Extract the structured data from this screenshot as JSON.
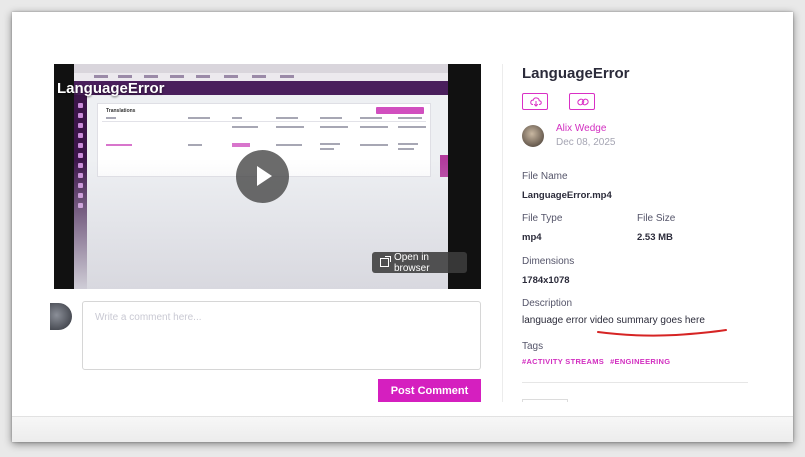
{
  "video": {
    "overlay_title": "LanguageError",
    "open_in_browser_label": "Open in browser",
    "embedded_screen_title": "Translations"
  },
  "comment": {
    "placeholder": "Write a comment here...",
    "post_label": "Post Comment"
  },
  "file": {
    "title": "LanguageError",
    "author": "Alix Wedge",
    "date": "Dec 08, 2025",
    "file_name_label": "File Name",
    "file_name": "LanguageError.mp4",
    "file_type_label": "File Type",
    "file_type": "mp4",
    "file_size_label": "File Size",
    "file_size": "2.53 MB",
    "dimensions_label": "Dimensions",
    "dimensions": "1784x1078",
    "description_label": "Description",
    "description": "language error video summary goes here",
    "tags_label": "Tags",
    "tags": [
      "#ACTIVITY STREAMS",
      "#ENGINEERING"
    ]
  },
  "icons": {
    "download": "download-icon",
    "link": "link-icon",
    "play": "play-icon",
    "external": "external-link-icon"
  },
  "colors": {
    "accent": "#d51fbf",
    "annotation_underline": "#d62424",
    "title_text": "#2b2b3a"
  }
}
